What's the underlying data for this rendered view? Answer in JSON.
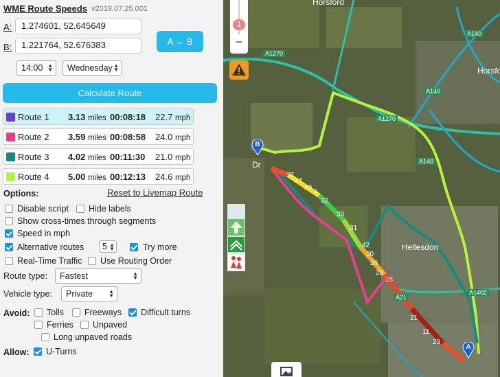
{
  "header": {
    "title": "WME Route Speeds",
    "version": "v2019.07.25.001"
  },
  "points": {
    "a_label": "A:",
    "a_value": "1.274601, 52.645649",
    "b_label": "B:",
    "b_value": "1.221764, 52.676383",
    "swap_label": "A ↔ B"
  },
  "time": {
    "hour": "14:00",
    "day": "Wednesday"
  },
  "calculate_label": "Calculate Route",
  "routes": [
    {
      "label": "Route 1",
      "distance": "3.13",
      "dist_unit": "miles",
      "time": "00:08:18",
      "speed": "22.7",
      "speed_unit": "mph",
      "color": "#6a3fd6"
    },
    {
      "label": "Route 2",
      "distance": "3.59",
      "dist_unit": "miles",
      "time": "00:08:58",
      "speed": "24.0",
      "speed_unit": "mph",
      "color": "#e83e8c"
    },
    {
      "label": "Route 3",
      "distance": "4.02",
      "dist_unit": "miles",
      "time": "00:11:30",
      "speed": "21.0",
      "speed_unit": "mph",
      "color": "#168b82"
    },
    {
      "label": "Route 4",
      "distance": "5.00",
      "dist_unit": "miles",
      "time": "00:12:13",
      "speed": "24.6",
      "speed_unit": "mph",
      "color": "#b8f23a"
    }
  ],
  "options": {
    "heading": "Options:",
    "reset_link": "Reset to Livemap Route",
    "disable_script": "Disable script",
    "hide_labels": "Hide labels",
    "cross_times": "Show cross-times through segments",
    "speed_mph": "Speed in mph",
    "alt_routes": "Alternative routes",
    "alt_count": "5",
    "try_more": "Try more",
    "realtime": "Real-Time Traffic",
    "routing_order": "Use Routing Order",
    "route_type_label": "Route type:",
    "route_type_value": "Fastest",
    "vehicle_label": "Vehicle type:",
    "vehicle_value": "Private",
    "avoid_label": "Avoid:",
    "tolls": "Tolls",
    "freeways": "Freeways",
    "difficult_turns": "Difficult turns",
    "ferries": "Ferries",
    "unpaved": "Unpaved",
    "long_unpaved": "Long unpaved roads",
    "allow_label": "Allow:",
    "uturns": "U-Turns"
  },
  "map": {
    "zoom_level": "1",
    "places": [
      "Horsford",
      "Horsford St-Fa",
      "Hellesdon",
      "Dr"
    ],
    "road_labels": [
      "A1270",
      "A140",
      "A140",
      "A1270",
      "A140",
      "A1402",
      "A21"
    ],
    "segment_labels": [
      "27",
      "27",
      "29",
      "9",
      "32",
      "33",
      "31",
      "42",
      "30",
      "26",
      "25",
      "15",
      "21",
      "11",
      "23"
    ],
    "pin_a": "A",
    "pin_b": "B"
  }
}
